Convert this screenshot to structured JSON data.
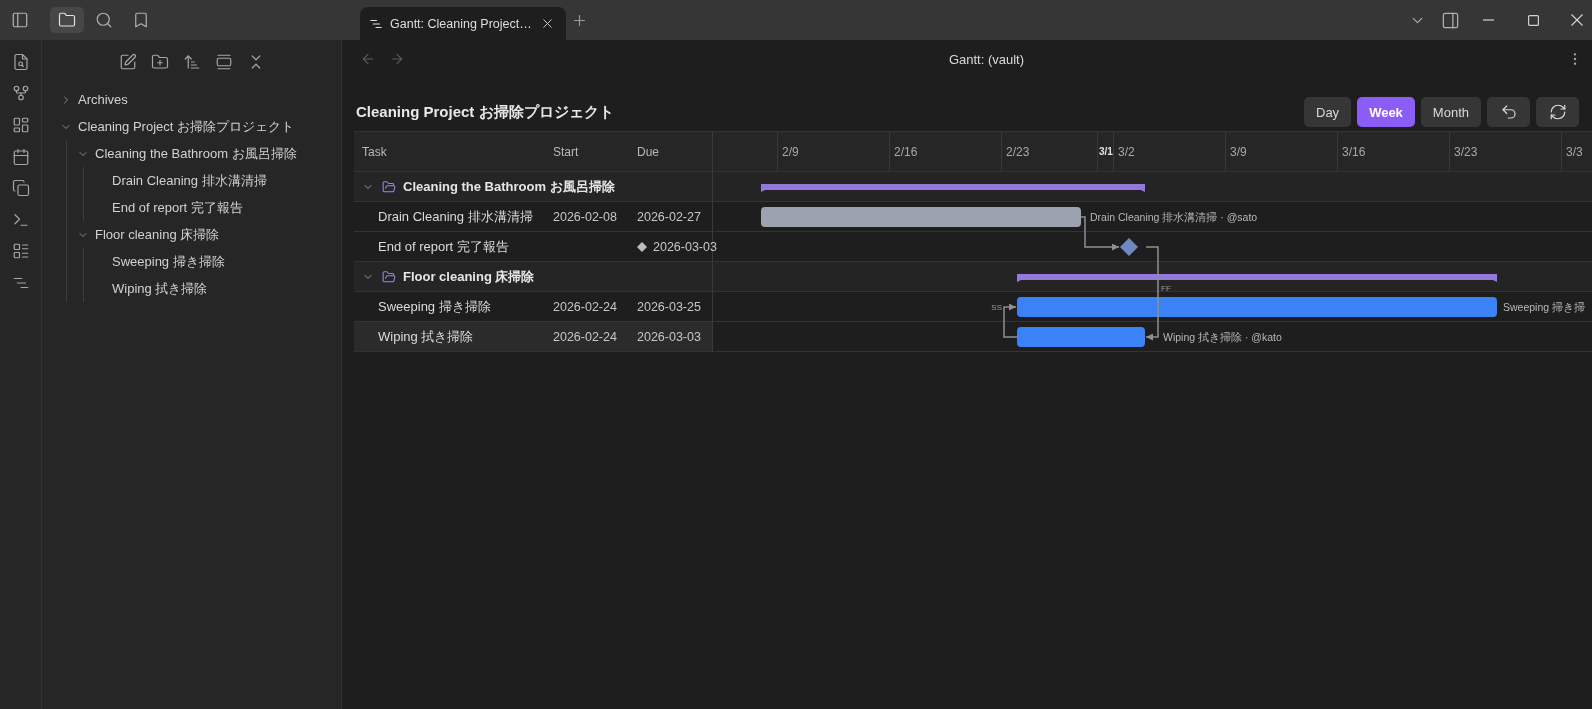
{
  "sidebar_tabs": [
    {
      "selected": true
    },
    {
      "selected": false
    },
    {
      "selected": false
    }
  ],
  "tabs": [
    {
      "title": "Gantt: Cleaning Project…",
      "selected": true
    }
  ],
  "file_tree": [
    {
      "name": "Archives",
      "kind": "folder",
      "expanded": false
    },
    {
      "name": "Cleaning Project お掃除プロジェクト",
      "kind": "folder",
      "expanded": true,
      "children": [
        {
          "name": "Cleaning the Bathroom お風呂掃除",
          "kind": "folder",
          "expanded": true,
          "children": [
            {
              "name": "Drain Cleaning 排水溝清掃",
              "kind": "file"
            },
            {
              "name": "End of report 完了報告",
              "kind": "file"
            }
          ]
        },
        {
          "name": "Floor cleaning 床掃除",
          "kind": "folder",
          "expanded": true,
          "children": [
            {
              "name": "Sweeping 掃き掃除",
              "kind": "file"
            },
            {
              "name": "Wiping 拭き掃除",
              "kind": "file"
            }
          ]
        }
      ]
    }
  ],
  "nav_buttons": [
    {
      "disabled": true
    },
    {
      "disabled": true
    }
  ],
  "view": {
    "title": "Gantt: (vault)"
  },
  "gantt": {
    "title": "Cleaning Project お掃除プロジェクト",
    "scale_buttons": [
      {
        "label": "Day",
        "selected": false
      },
      {
        "label": "Week",
        "selected": true
      },
      {
        "label": "Month",
        "selected": false
      }
    ],
    "columns": [
      {
        "label": "Task"
      },
      {
        "label": "Start"
      },
      {
        "label": "Due"
      }
    ],
    "timeline": [
      {
        "label": "2/9",
        "kind": "week"
      },
      {
        "label": "2/16",
        "kind": "week"
      },
      {
        "label": "2/23",
        "kind": "week"
      },
      {
        "label": "3/1",
        "kind": "month"
      },
      {
        "label": "3/2",
        "kind": "week"
      },
      {
        "label": "3/9",
        "kind": "week"
      },
      {
        "label": "3/16",
        "kind": "week"
      },
      {
        "label": "3/23",
        "kind": "week"
      },
      {
        "label": "3/3",
        "kind": "week"
      }
    ],
    "groups": [
      {
        "name": "Cleaning the Bathroom お風呂掃除",
        "expanded": true,
        "tasks": [
          {
            "kind": "bar",
            "name": "Drain Cleaning 排水溝清掃",
            "start": "2026-02-08",
            "due": "2026-02-27",
            "color": "#9ca3af",
            "bar_label": "Drain Cleaning 排水溝清掃 · @sato",
            "selected": false
          },
          {
            "kind": "milestone",
            "name": "End of report 完了報告",
            "due": "2026-03-03",
            "selected": false
          }
        ]
      },
      {
        "name": "Floor cleaning 床掃除",
        "expanded": true,
        "tasks": [
          {
            "kind": "bar",
            "name": "Sweeping 掃き掃除",
            "start": "2026-02-24",
            "due": "2026-03-25",
            "color": "#3b82f6",
            "bar_label": "Sweeping 掃き掃",
            "selected": false
          },
          {
            "kind": "bar",
            "name": "Wiping 拭き掃除",
            "start": "2026-02-24",
            "due": "2026-03-03",
            "color": "#3b82f6",
            "bar_label": "Wiping 拭き掃除 · @kato",
            "selected": true
          }
        ]
      }
    ],
    "links": [
      {
        "kind": "finish-start"
      },
      {
        "kind": "finish-finish",
        "label": "FF"
      },
      {
        "kind": "start-start",
        "label": "SS"
      }
    ]
  }
}
